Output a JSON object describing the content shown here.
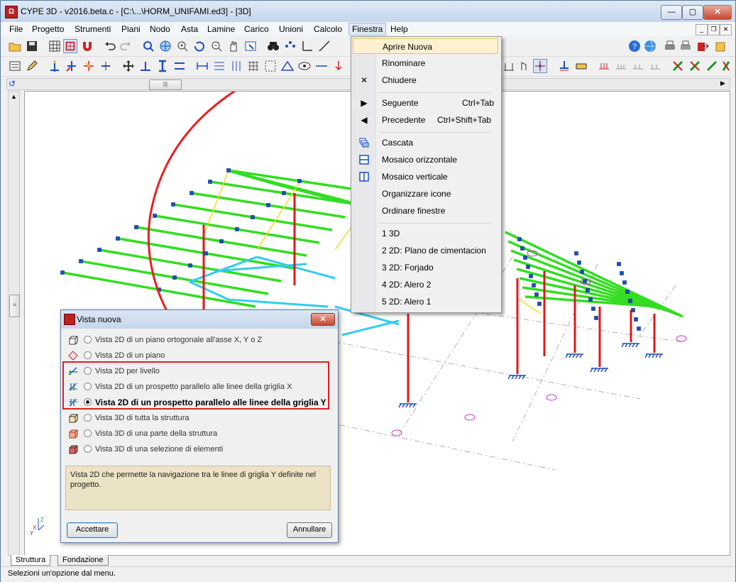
{
  "window": {
    "title": "CYPE 3D - v2016.beta.c - [C:\\...\\HORM_UNIFAMI.ed3] - [3D]"
  },
  "menubar": [
    "File",
    "Progetto",
    "Strumenti",
    "Piani",
    "Nodo",
    "Asta",
    "Lamine",
    "Carico",
    "Unioni",
    "Calcolo",
    "Finestra",
    "Help"
  ],
  "finestra_menu": {
    "items": [
      {
        "label": "Aprire Nuova",
        "shortcut": "",
        "icon": ""
      },
      {
        "label": "Rinominare",
        "shortcut": "",
        "icon": ""
      },
      {
        "label": "Chiudere",
        "shortcut": "",
        "icon": "close-x-icon"
      },
      {
        "label": "Seguente",
        "shortcut": "Ctrl+Tab",
        "icon": "arrow-right-icon"
      },
      {
        "label": "Precedente",
        "shortcut": "Ctrl+Shift+Tab",
        "icon": "arrow-left-icon"
      },
      {
        "label": "Cascata",
        "shortcut": "",
        "icon": "cascade-icon"
      },
      {
        "label": "Mosaico orizzontale",
        "shortcut": "",
        "icon": "tile-horizontal-icon"
      },
      {
        "label": "Mosaico verticale",
        "shortcut": "",
        "icon": "tile-vertical-icon"
      },
      {
        "label": "Organizzare icone",
        "shortcut": "",
        "icon": ""
      },
      {
        "label": "Ordinare finestre",
        "shortcut": "",
        "icon": ""
      },
      {
        "label": "1 3D",
        "shortcut": "",
        "icon": ""
      },
      {
        "label": "2 2D: Plano de cimentacion",
        "shortcut": "",
        "icon": ""
      },
      {
        "label": "3 2D: Forjado",
        "shortcut": "",
        "icon": ""
      },
      {
        "label": "4 2D: Alero 2",
        "shortcut": "",
        "icon": ""
      },
      {
        "label": "5 2D: Alero 1",
        "shortcut": "",
        "icon": ""
      }
    ]
  },
  "dialog": {
    "title": "Vista nuova",
    "options": [
      {
        "label": "Vista 2D di un piano ortogonale all'asse X, Y o Z",
        "selected": false
      },
      {
        "label": "Vista 2D di un piano",
        "selected": false
      },
      {
        "label": "Vista 2D per livello",
        "selected": false
      },
      {
        "label": "Vista 2D di un prospetto parallelo alle linee della griglia X",
        "selected": false
      },
      {
        "label": "Vista 2D di un prospetto parallelo alle linee della griglia Y",
        "selected": true
      },
      {
        "label": "Vista 3D di tutta la struttura",
        "selected": false
      },
      {
        "label": "Vista 3D di una parte della struttura",
        "selected": false
      },
      {
        "label": "Vista 3D di una selezione di elementi",
        "selected": false
      }
    ],
    "description": "Vista 2D che permette la navigazione tra le linee di griglia Y definite nel progetto.",
    "accept_label": "Accettare",
    "cancel_label": "Annullare"
  },
  "tabs": [
    "Struttura",
    "Fondazione"
  ],
  "status": "Selezioni un'opzione dal menu.",
  "colors": {
    "beam": "#33dd22",
    "column": "#e01818",
    "steel": "#33ccee",
    "node": "#1a4fc0",
    "highlight": "#e02020"
  }
}
